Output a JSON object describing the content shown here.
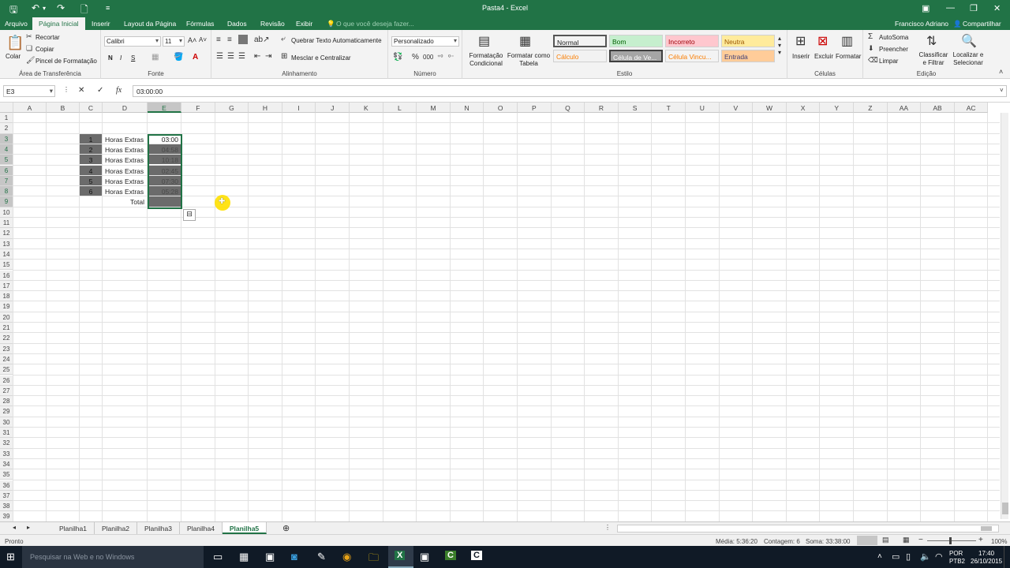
{
  "window": {
    "title": "Pasta4 - Excel",
    "user": "Francisco Adriano",
    "share": "Compartilhar"
  },
  "ribbon_tabs": [
    "Arquivo",
    "Página Inicial",
    "Inserir",
    "Layout da Página",
    "Fórmulas",
    "Dados",
    "Revisão",
    "Exibir"
  ],
  "tell_me": "O que você deseja fazer...",
  "clipboard": {
    "paste": "Colar",
    "cut": "Recortar",
    "copy": "Copiar",
    "format_painter": "Pincel de Formatação",
    "group": "Área de Transferência"
  },
  "font": {
    "name": "Calibri",
    "size": "11",
    "bold": "N",
    "italic": "I",
    "underline": "S",
    "group": "Fonte"
  },
  "alignment": {
    "wrap": "Quebrar Texto Automaticamente",
    "merge": "Mesclar e Centralizar",
    "group": "Alinhamento"
  },
  "number": {
    "format": "Personalizado",
    "group": "Número"
  },
  "styles": {
    "conditional": "Formatação Condicional",
    "as_table": "Formatar como Tabela",
    "items": [
      {
        "label": "Normal",
        "bg": "#ffffff",
        "fg": "#000000"
      },
      {
        "label": "Bom",
        "bg": "#c6efce",
        "fg": "#006100"
      },
      {
        "label": "Incorreto",
        "bg": "#ffc7ce",
        "fg": "#9c0006"
      },
      {
        "label": "Neutra",
        "bg": "#ffeb9c",
        "fg": "#9c5700"
      },
      {
        "label": "Cálculo",
        "bg": "#f2f2f2",
        "fg": "#fa7d00"
      },
      {
        "label": "Célula de Ve...",
        "bg": "#a5a5a5",
        "fg": "#ffffff"
      },
      {
        "label": "Célula Vincu...",
        "bg": "#ffffff",
        "fg": "#fa7d00"
      },
      {
        "label": "Entrada",
        "bg": "#ffcc99",
        "fg": "#3f3f76"
      }
    ],
    "group": "Estilo"
  },
  "cells_group": {
    "insert": "Inserir",
    "delete": "Excluir",
    "format": "Formatar",
    "group": "Células"
  },
  "editing": {
    "autosum": "AutoSoma",
    "fill": "Preencher",
    "clear": "Limpar",
    "sort": "Classificar e Filtrar",
    "find": "Localizar e Selecionar",
    "group": "Edição"
  },
  "formula_bar": {
    "name_box": "E3",
    "formula": "03:00:00"
  },
  "columns": [
    "A",
    "B",
    "C",
    "D",
    "E",
    "F",
    "G",
    "H",
    "I",
    "J",
    "K",
    "L",
    "M",
    "N",
    "O",
    "P",
    "Q",
    "R",
    "S",
    "T",
    "U",
    "V",
    "W",
    "X",
    "Y",
    "Z",
    "AA",
    "AB",
    "AC"
  ],
  "rows": [
    "1",
    "2",
    "3",
    "4",
    "5",
    "6",
    "7",
    "8",
    "9",
    "10",
    "11",
    "12",
    "13",
    "14",
    "15",
    "16",
    "17",
    "18",
    "19",
    "20",
    "21",
    "22",
    "23",
    "24",
    "25",
    "26",
    "27",
    "28",
    "29",
    "30",
    "31",
    "32",
    "33",
    "34",
    "35",
    "36",
    "37",
    "38",
    "39"
  ],
  "table": {
    "items": [
      {
        "n": "1",
        "label": "Horas Extras",
        "time": "03:00"
      },
      {
        "n": "2",
        "label": "Horas Extras",
        "time": "04:58"
      },
      {
        "n": "3",
        "label": "Horas Extras",
        "time": "10:18"
      },
      {
        "n": "4",
        "label": "Horas Extras",
        "time": "02:45"
      },
      {
        "n": "5",
        "label": "Horas Extras",
        "time": "07:30"
      },
      {
        "n": "6",
        "label": "Horas Extras",
        "time": "05:28"
      }
    ],
    "total_label": "Total"
  },
  "sheets": [
    "Planilha1",
    "Planilha2",
    "Planilha3",
    "Planilha4",
    "Planilha5"
  ],
  "status": {
    "ready": "Pronto",
    "average": "Média: 5:36:20",
    "count": "Contagem: 6",
    "sum": "Soma: 33:38:00",
    "zoom": "100%"
  },
  "taskbar": {
    "search": "Pesquisar na Web e no Windows",
    "lang1": "POR",
    "lang2": "PTB2",
    "time": "17:40",
    "date": "26/10/2015"
  },
  "colors": {
    "excel_green": "#217346"
  }
}
